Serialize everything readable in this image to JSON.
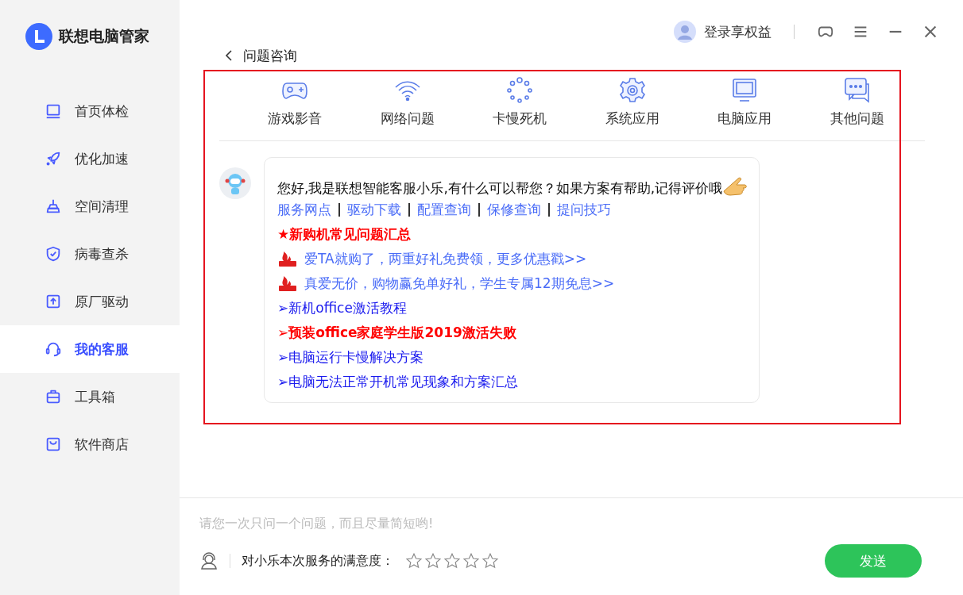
{
  "app": {
    "title": "联想电脑管家"
  },
  "sidebar": {
    "items": [
      {
        "label": "首页体检",
        "selected": false
      },
      {
        "label": "优化加速",
        "selected": false
      },
      {
        "label": "空间清理",
        "selected": false
      },
      {
        "label": "病毒查杀",
        "selected": false
      },
      {
        "label": "原厂驱动",
        "selected": false
      },
      {
        "label": "我的客服",
        "selected": true
      },
      {
        "label": "工具箱",
        "selected": false
      },
      {
        "label": "软件商店",
        "selected": false
      }
    ]
  },
  "header": {
    "login": "登录享权益"
  },
  "page": {
    "back_title": "问题咨询"
  },
  "categories": [
    {
      "label": "游戏影音"
    },
    {
      "label": "网络问题"
    },
    {
      "label": "卡慢死机"
    },
    {
      "label": "系统应用"
    },
    {
      "label": "电脑应用"
    },
    {
      "label": "其他问题"
    }
  ],
  "message": {
    "greeting": "您好,我是联想智能客服小乐,有什么可以帮您？如果方案有帮助,记得评价哦",
    "quick_links": [
      "服务网点",
      "驱动下载",
      "配置查询",
      "保修查询",
      "提问技巧"
    ],
    "items": [
      {
        "kind": "bullet",
        "bullet": "★",
        "text": "新购机常见问题汇总",
        "highlight": true
      },
      {
        "kind": "hot",
        "text": "爱TA就购了，两重好礼免费领，更多优惠戳>>"
      },
      {
        "kind": "hot",
        "text": "真爱无价，购物赢免单好礼，学生专属12期免息>>"
      },
      {
        "kind": "bullet",
        "bullet": "➢",
        "text": "新机office激活教程",
        "highlight": false
      },
      {
        "kind": "bullet",
        "bullet": "➢",
        "text": "预装office家庭学生版2019激活失败",
        "highlight": true
      },
      {
        "kind": "bullet",
        "bullet": "➢",
        "text": "电脑运行卡慢解决方案",
        "highlight": false
      },
      {
        "kind": "bullet",
        "bullet": "➢",
        "text": "电脑无法正常开机常见现象和方案汇总",
        "highlight": false
      }
    ]
  },
  "input": {
    "placeholder": "请您一次只问一个问题，而且尽量简短哟!"
  },
  "rating": {
    "label": "对小乐本次服务的满意度：",
    "stars": 0
  },
  "send_button": "发送"
}
